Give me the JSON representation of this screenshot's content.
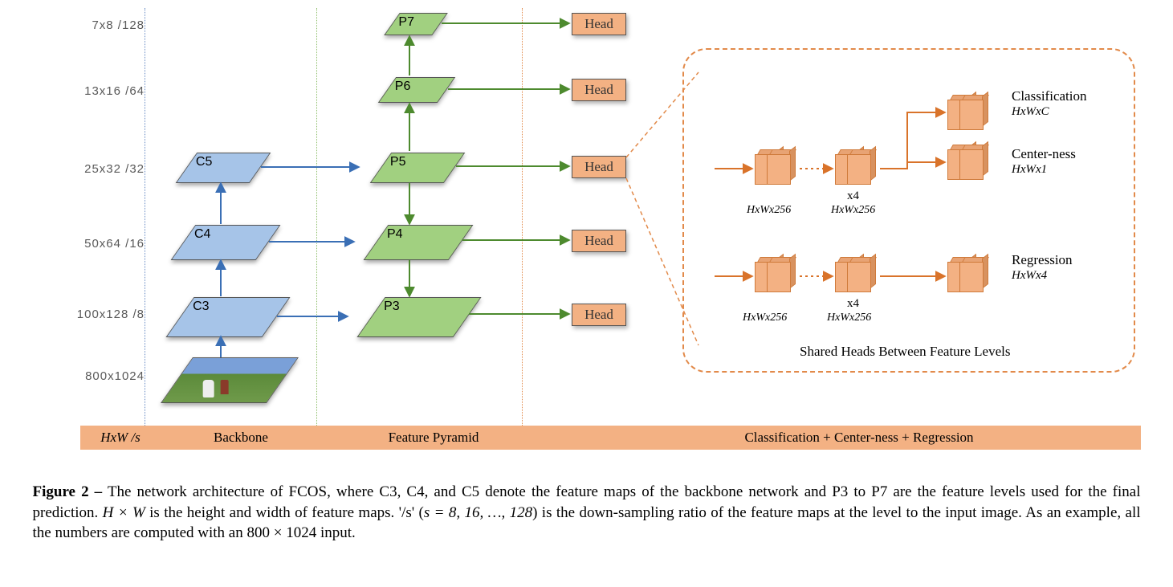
{
  "scales": [
    {
      "label": "7x8  /128"
    },
    {
      "label": "13x16  /64"
    },
    {
      "label": "25x32  /32"
    },
    {
      "label": "50x64  /16"
    },
    {
      "label": "100x128  /8"
    },
    {
      "label": "800x1024"
    }
  ],
  "corner_label": "HxW /s",
  "backbone": {
    "title": "Backbone",
    "blocks": [
      "C5",
      "C4",
      "C3"
    ]
  },
  "fpn": {
    "title": "Feature Pyramid",
    "blocks": [
      "P7",
      "P6",
      "P5",
      "P4",
      "P3"
    ]
  },
  "heads": {
    "label": "Head",
    "count": 5,
    "column_title": "Classification + Center-ness + Regression"
  },
  "detail": {
    "caption": "Shared Heads Between Feature Levels",
    "branches": {
      "classification": {
        "title": "Classification",
        "dim": "HxWxC"
      },
      "centerness": {
        "title": "Center-ness",
        "dim": "HxWx1"
      },
      "regression": {
        "title": "Regression",
        "dim": "HxWx4"
      }
    },
    "conv_dim": "HxWx256",
    "repeat": "x4"
  },
  "caption": {
    "label": "Figure 2 –",
    "body1": " The network architecture of FCOS, where C3, C4, and C5 denote the feature maps of the backbone network and P3 to P7 are the feature levels used for the final prediction.  ",
    "hw": "H × W",
    "body2": " is the height and width of feature maps.  '/s' (",
    "s_eq": "s = 8, 16, …, 128",
    "body3": ") is the down-sampling ratio of the feature maps at the level to the input image.  As an example, all the numbers are computed with an 800 × 1024 input."
  }
}
